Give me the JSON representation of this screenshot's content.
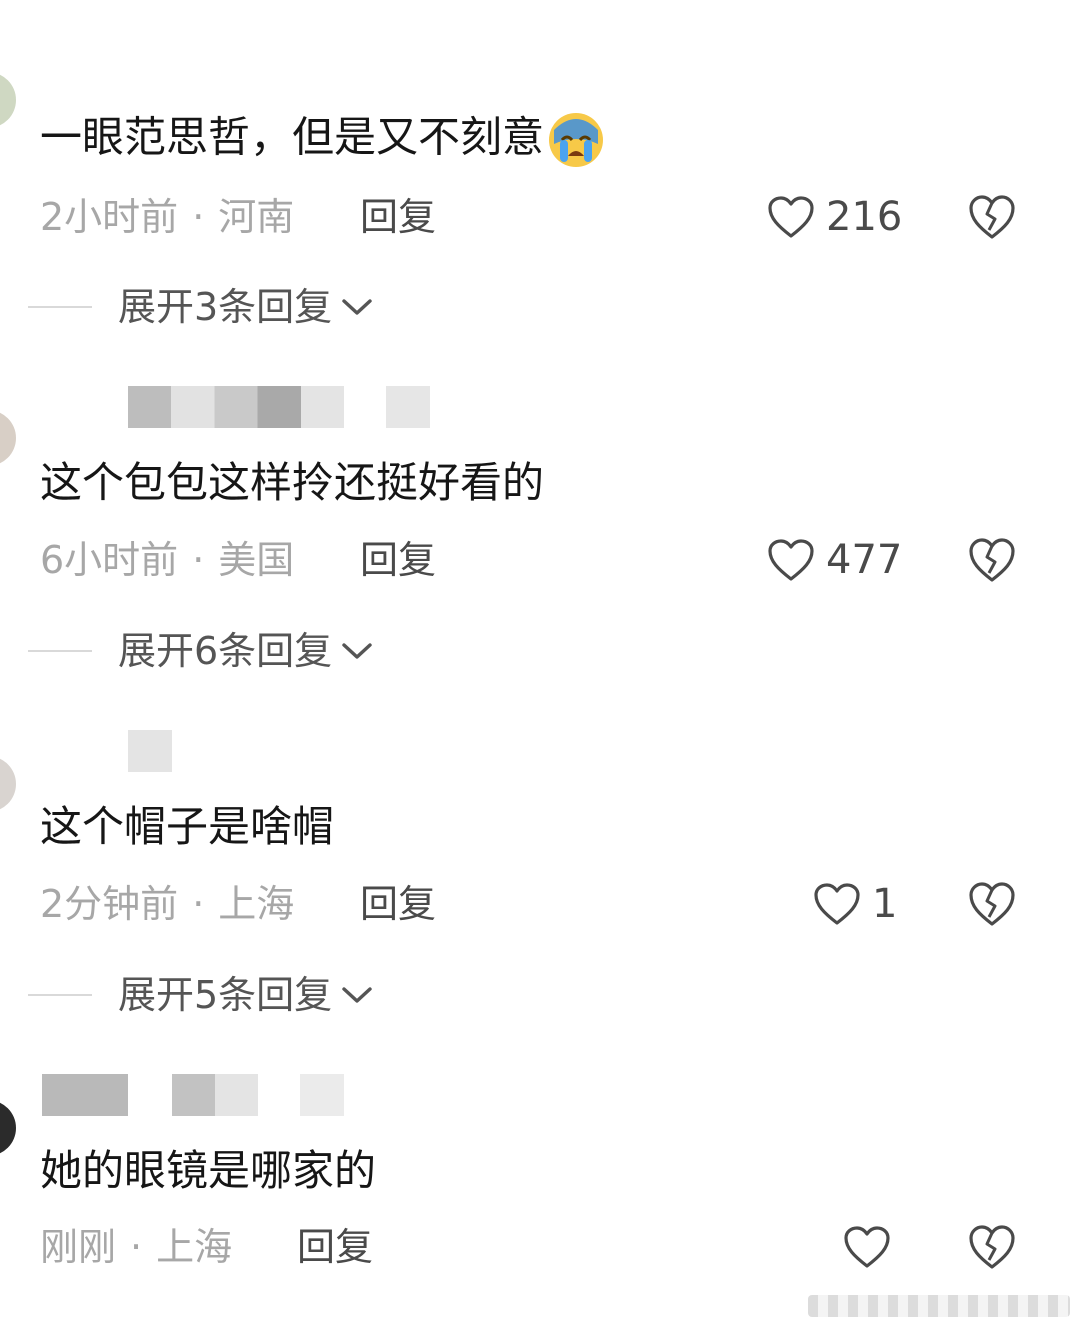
{
  "comments": [
    {
      "text": "一眼范思哲，但是又不刻意",
      "emoji": "loudly-crying-face",
      "time": "2小时前",
      "location": "河南",
      "reply_label": "回复",
      "likes": "216",
      "expand_label": "展开3条回复"
    },
    {
      "text": "这个包包这样拎还挺好看的",
      "time": "6小时前",
      "location": "美国",
      "reply_label": "回复",
      "likes": "477",
      "expand_label": "展开6条回复"
    },
    {
      "text": "这个帽子是啥帽",
      "time": "2分钟前",
      "location": "上海",
      "reply_label": "回复",
      "likes": "1",
      "expand_label": "展开5条回复"
    },
    {
      "text": "她的眼镜是哪家的",
      "time": "刚刚",
      "location": "上海",
      "reply_label": "回复",
      "likes": ""
    }
  ],
  "separator": "·",
  "icons": {
    "like": "heart-outline-icon",
    "dislike": "broken-heart-icon",
    "expand": "chevron-down-icon"
  },
  "colors": {
    "text": "#161616",
    "meta": "#a7a7a7",
    "action": "#4a4a4a"
  }
}
